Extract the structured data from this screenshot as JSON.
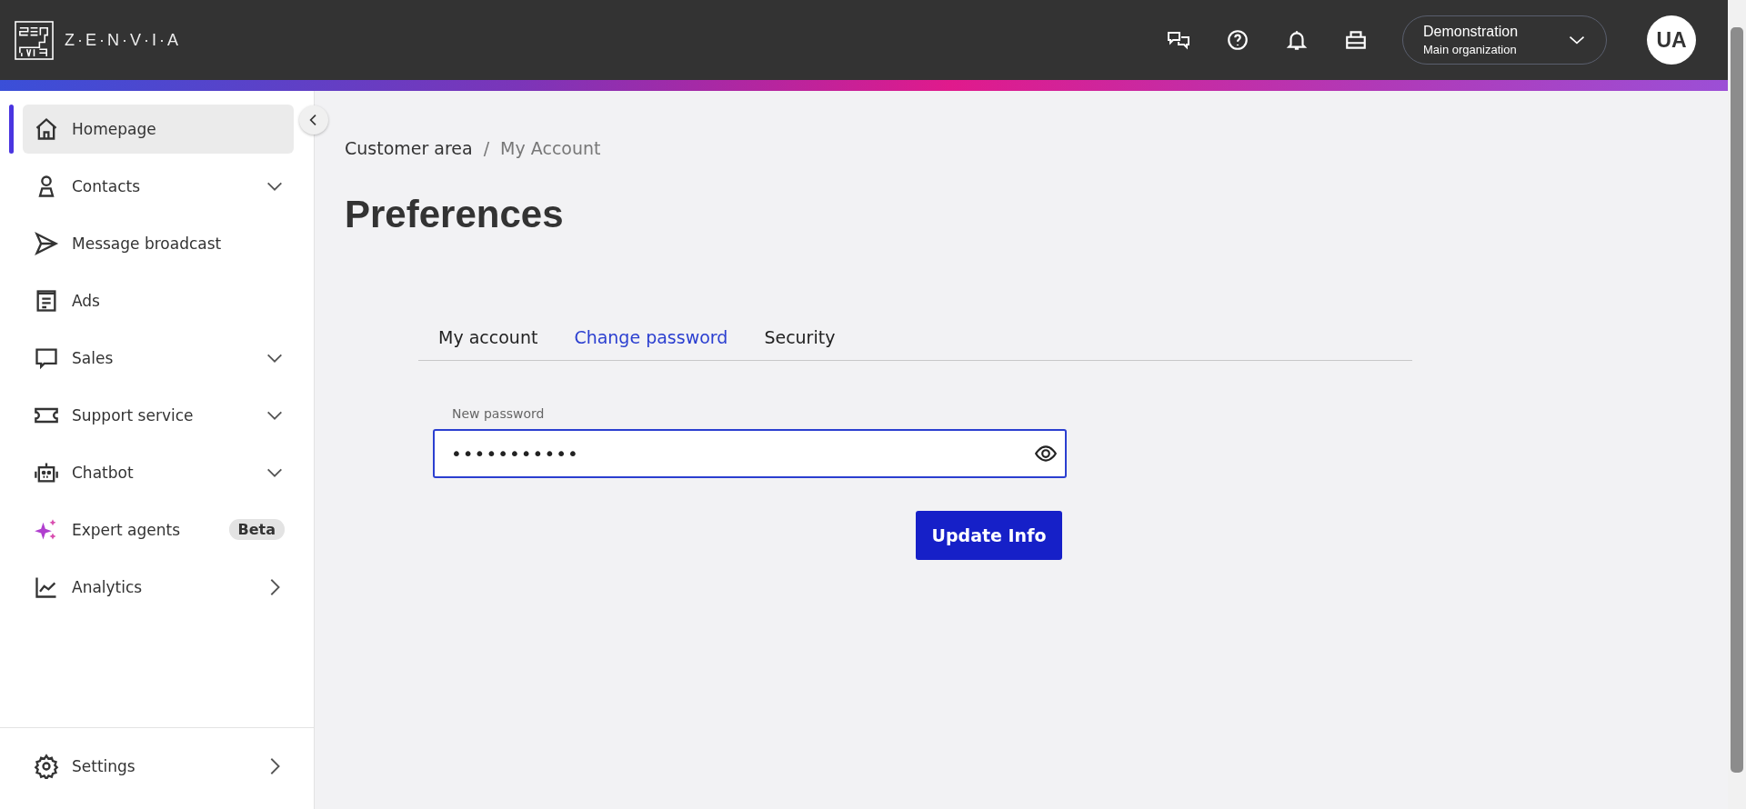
{
  "header": {
    "logo_text": "Z·E·N·V·I·A",
    "organization": {
      "name": "Demonstration",
      "subtitle": "Main organization"
    },
    "avatar": "UA"
  },
  "sidebar": {
    "items": [
      {
        "label": "Homepage",
        "selected": true,
        "kind": "plain"
      },
      {
        "label": "Contacts",
        "selected": false,
        "kind": "expand"
      },
      {
        "label": "Message broadcast",
        "selected": false,
        "kind": "plain"
      },
      {
        "label": "Ads",
        "selected": false,
        "kind": "plain"
      },
      {
        "label": "Sales",
        "selected": false,
        "kind": "expand"
      },
      {
        "label": "Support service",
        "selected": false,
        "kind": "expand"
      },
      {
        "label": "Chatbot",
        "selected": false,
        "kind": "expand"
      },
      {
        "label": "Expert agents",
        "selected": false,
        "kind": "badge",
        "badge": "Beta"
      },
      {
        "label": "Analytics",
        "selected": false,
        "kind": "submenu"
      }
    ],
    "footer_item": {
      "label": "Settings",
      "selected": false,
      "kind": "submenu"
    }
  },
  "breadcrumb": [
    "Customer area",
    "My Account"
  ],
  "breadcrumb_separator": "/",
  "title": "Preferences",
  "tabs": [
    {
      "label": "My account",
      "selected": false
    },
    {
      "label": "Change password",
      "selected": true
    },
    {
      "label": "Security",
      "selected": false
    }
  ],
  "form": {
    "label": "New password",
    "value": "•••••••••••",
    "button": "Update Info"
  }
}
